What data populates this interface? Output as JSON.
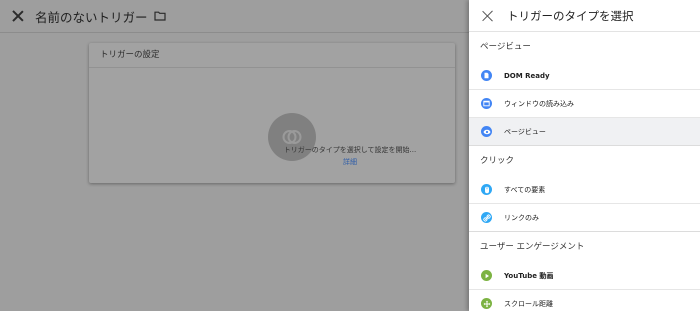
{
  "editor": {
    "title": "名前のないトリガー",
    "card_title": "トリガーの設定",
    "hint": "トリガーのタイプを選択して設定を開始...",
    "learn_more": "詳細"
  },
  "panel": {
    "title": "トリガーのタイプを選択",
    "sections": [
      {
        "heading": "ページビュー",
        "items": [
          {
            "label": "DOM Ready",
            "icon": "document-icon",
            "color": "#4285f4"
          },
          {
            "label": "ウィンドウの読み込み",
            "icon": "window-icon",
            "color": "#4285f4"
          },
          {
            "label": "ページビュー",
            "icon": "eye-icon",
            "color": "#4285f4",
            "selected": true
          }
        ]
      },
      {
        "heading": "クリック",
        "items": [
          {
            "label": "すべての要素",
            "icon": "mouse-icon",
            "color": "#2fa8f5"
          },
          {
            "label": "リンクのみ",
            "icon": "link-icon",
            "color": "#2fa8f5"
          }
        ]
      },
      {
        "heading": "ユーザー エンゲージメント",
        "items": [
          {
            "label": "YouTube 動画",
            "icon": "play-icon",
            "color": "#7cb342"
          },
          {
            "label": "スクロール距離",
            "icon": "move-icon",
            "color": "#7cb342"
          }
        ]
      }
    ]
  },
  "colors": {
    "scrim": "#9e9e9e",
    "accent_blue": "#4285f4",
    "click_blue": "#2fa8f5",
    "engagement_green": "#7cb342",
    "link": "#2f5da8"
  }
}
